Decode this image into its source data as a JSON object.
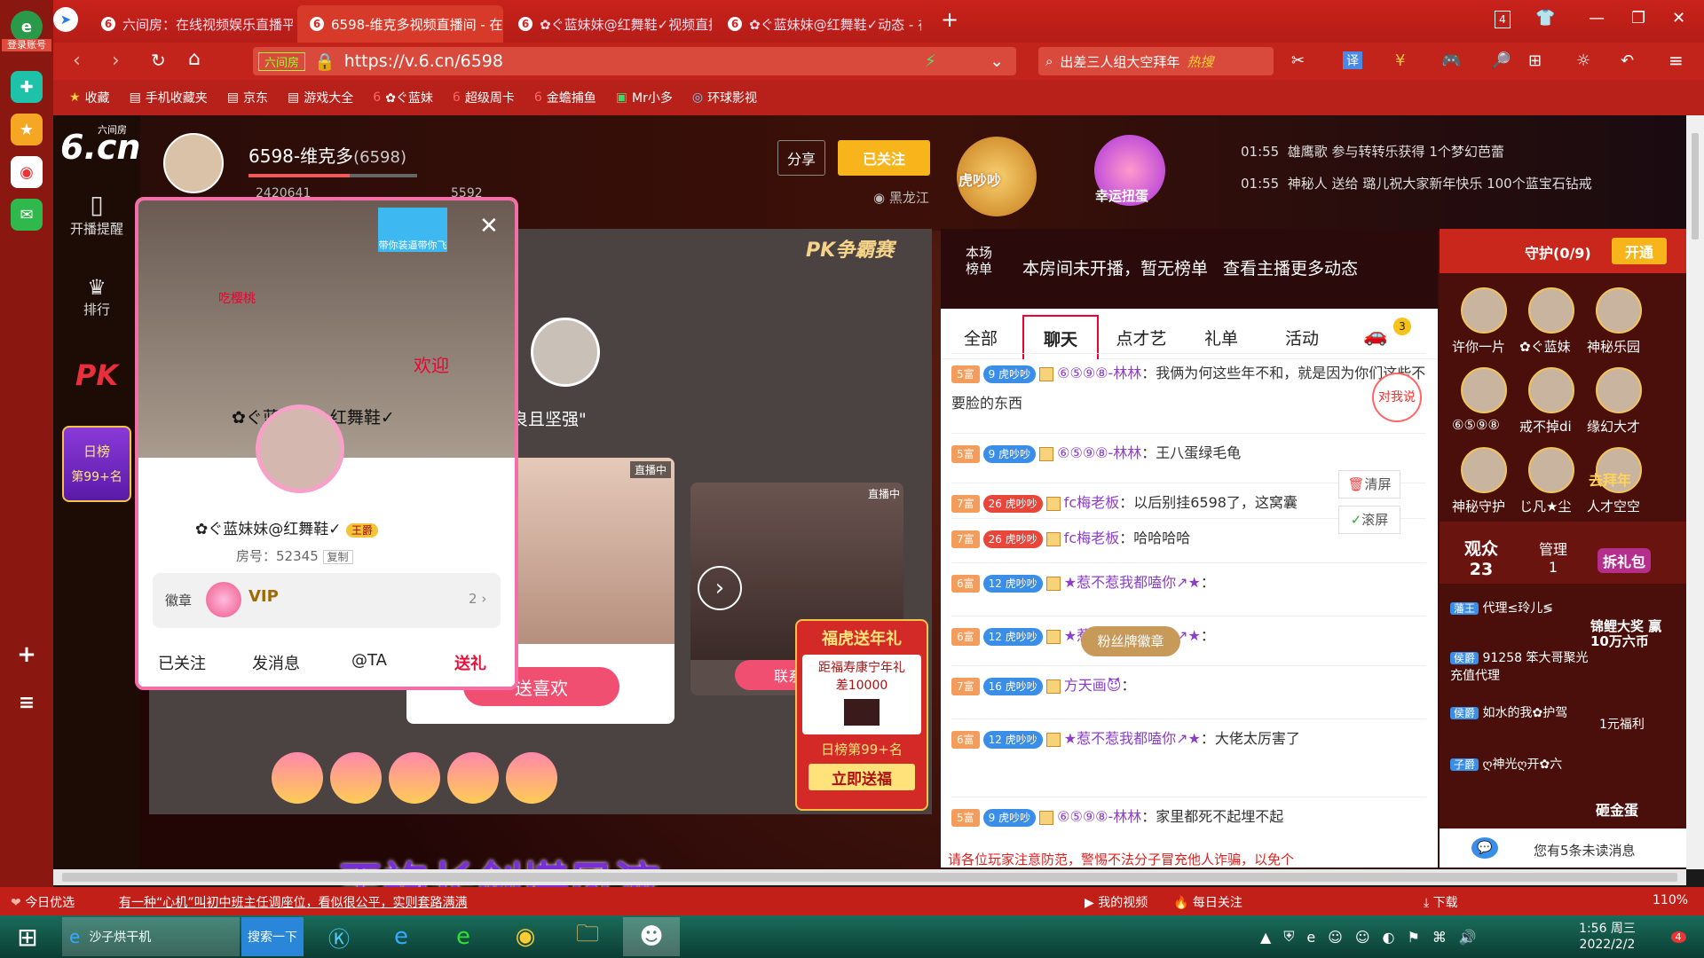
{
  "browser": {
    "login_label": "登录账号",
    "tabs": [
      {
        "label": "六间房：在线视频娱乐直播平"
      },
      {
        "label": "6598-维克多视频直播间 - 在线",
        "active": true
      },
      {
        "label": "✿ぐ蓝妹妹@红舞鞋✓视频直播"
      },
      {
        "label": "✿ぐ蓝妹妹@红舞鞋✓动态 - 在"
      }
    ],
    "tab_count": "4",
    "url_site_tag": "六间房",
    "url": "https://v.6.cn/6598",
    "search_text": "出差三人组大空拜年",
    "search_hot": "热搜",
    "bookmarks": [
      "收藏",
      "手机收藏夹",
      "京东",
      "游戏大全",
      "✿ぐ蓝妹",
      "超级周卡",
      "金蟾捕鱼",
      "Mr小多",
      "环球影视"
    ]
  },
  "site": {
    "logo_top": "六间房",
    "logo_text": "6.cn",
    "nav": [
      {
        "label": "开播提醒",
        "icon": "phone-icon"
      },
      {
        "label": "排行",
        "icon": "crown-icon"
      },
      {
        "label": "PK",
        "icon": "pk-icon"
      }
    ],
    "rank_badge_title": "日榜",
    "rank_badge_value": "第99+名"
  },
  "header": {
    "anchor_name": "6598-维克多",
    "anchor_id": "(6598)",
    "anchor_fans": "2420641",
    "anchor_coins": "5592",
    "share": "分享",
    "followed": "已关注",
    "location": "黑龙江",
    "tiger_label": "虎吵吵",
    "lucky_label": "幸运扭蛋",
    "announcements": [
      {
        "time": "01:55",
        "text": "雄鹰歌 参与转转乐获得 1个梦幻芭蕾"
      },
      {
        "time": "01:55",
        "text": "神秘人 送给 璐儿祝大家新年快乐 100个蓝宝石钻戒"
      }
    ]
  },
  "video": {
    "pk_label": "PK争霸赛",
    "caption": "良且坚强\"",
    "live_tag": "直播中",
    "live_tag2": "直播中",
    "like_button": "送喜欢",
    "like_button2": "联系",
    "overlay_text": "王袍长剑堪风流",
    "banner_title": "福虎送年礼",
    "banner_body1": "距福寿康宁年礼",
    "banner_body2": "差10000",
    "banner_rank": "日榜第99+名",
    "banner_cta": "立即送福"
  },
  "popup": {
    "name": "✿ぐ蓝妹妹@红舞鞋✓",
    "rank_tag": "王爵",
    "room_label": "房号：",
    "room_no": "52345",
    "copy": "复制",
    "badge_label": "徽章",
    "badge_count": "2",
    "vip": "VIP",
    "actions": [
      "已关注",
      "发消息",
      "@TA",
      "送礼"
    ],
    "banner_text": "带你装逼带你飞",
    "cherry_label": "吃樱桃",
    "welcome": "欢迎",
    "overlay_name": "✿ぐ蓝妹妹@红舞鞋✓"
  },
  "chat": {
    "rank_label": "本场榜单",
    "no_rank": "本房间未开播，暂无榜单",
    "more_link": "查看主播更多动态",
    "tabs": [
      "全部",
      "聊天",
      "点才艺",
      "礼单",
      "活动"
    ],
    "tab_badge": "3",
    "say_to_me": "对我说",
    "clear": "清屏",
    "scroll": "滚屏",
    "fan_badge": "粉丝牌徽章",
    "messages": [
      {
        "rich": "5富",
        "lvl": "9",
        "tag": "虎吵吵",
        "nick": "⑥⑤⑨⑧-林林",
        "text": "：我俩为何这些年不和，就是因为你们这些不要脸的东西"
      },
      {
        "rich": "5富",
        "lvl": "9",
        "tag": "虎吵吵",
        "nick": "⑥⑤⑨⑧-林林",
        "text": "：王八蛋绿毛龟"
      },
      {
        "rich": "7富",
        "lvl": "26",
        "tag": "虎吵吵",
        "nick": "fc梅老板",
        "text": "：以后别挂6598了，这窝囊"
      },
      {
        "rich": "7富",
        "lvl": "26",
        "tag": "虎吵吵",
        "nick": "fc梅老板",
        "text": "：哈哈哈哈"
      },
      {
        "rich": "6富",
        "lvl": "12",
        "tag": "虎吵吵",
        "nick": "★惹不惹我都嗑你↗★",
        "text": "："
      },
      {
        "rich": "6富",
        "lvl": "12",
        "tag": "虎吵吵",
        "nick": "★惹不惹我都嗑你↗★",
        "text": "："
      },
      {
        "rich": "7富",
        "lvl": "16",
        "tag": "虎吵吵",
        "nick": "方天画😈",
        "text": "："
      },
      {
        "rich": "6富",
        "lvl": "12",
        "tag": "虎吵吵",
        "nick": "★惹不惹我都嗑你↗★",
        "text": "：大佬太厉害了"
      },
      {
        "rich": "5富",
        "lvl": "9",
        "tag": "虎吵吵",
        "nick": "⑥⑤⑨⑧-林林",
        "text": "：家里都死不起埋不起"
      }
    ],
    "warning": "请各位玩家注意防范，警惕不法分子冒充他人诈骗，以免个"
  },
  "guard": {
    "title": "守护(0/9)",
    "open": "开通",
    "members": [
      "许你一片",
      "✿ぐ蓝妹",
      "神秘乐园",
      "⑥⑤⑨⑧",
      "戒不掉di",
      "缘幻大才",
      "神秘守护",
      "じ凡★尘",
      "人才空空"
    ],
    "side_labels": [
      "去拜年",
      "拆礼包",
      "锦鲤大奖 赢10万六币",
      "1元福利",
      "砸金蛋"
    ],
    "audience_label": "观众",
    "audience_count": "23",
    "admin_label": "管理",
    "admin_count": "1",
    "viewers": [
      {
        "tag": "藩王",
        "name": "代理≤玲儿≶"
      },
      {
        "tag": "侯爵",
        "name": "91258 笨大哥聚光充值代理"
      },
      {
        "tag": "侯爵",
        "name": "如水的我✿护驾"
      },
      {
        "tag": "子爵",
        "name": "ღ神光ღ开✿六"
      }
    ],
    "unread": "您有5条未读消息"
  },
  "statusbar": {
    "today": "今日优选",
    "news": "有一种“心机”叫初中班主任调座位，看似很公平，实则套路满满",
    "items": [
      "我的视频",
      "每日关注",
      "下载"
    ],
    "zoom": "110%"
  },
  "taskbar": {
    "search_item": "沙子烘干机",
    "search_btn": "搜索一下",
    "time": "1:56 周三",
    "date": "2022/2/2",
    "notif": "4"
  },
  "colors": {
    "brand": "#c8221a",
    "accent": "#f46ea8",
    "gold": "#f8b51b"
  }
}
